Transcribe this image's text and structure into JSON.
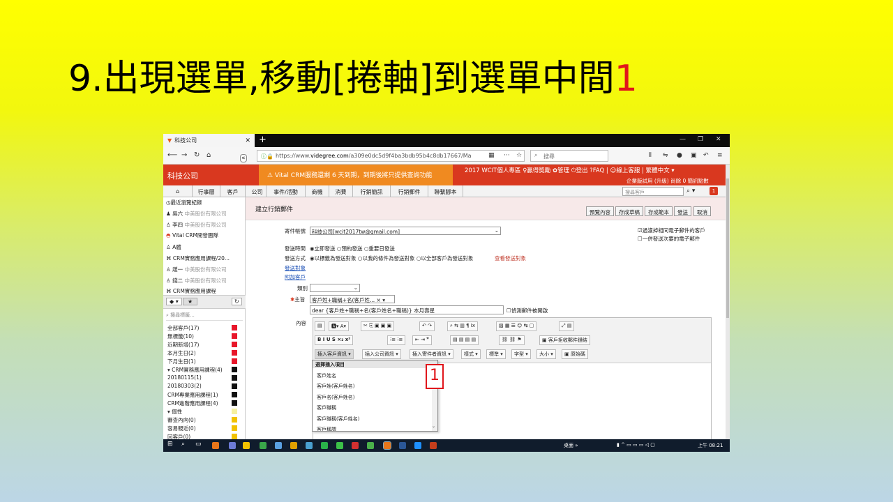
{
  "slide": {
    "title": "9.出現選單,移動[捲軸]到選單中間",
    "title_number": "1"
  },
  "browser": {
    "tab_title": "科技公司",
    "url_prefix": "https://www.",
    "url_host": "videgree.com",
    "url_rest": "/a309e0dc5d9f4ba3bdb95b4c8db17667/Ma",
    "search_placeholder": "搜尋"
  },
  "crm": {
    "logo": "科技公司",
    "notice": "⚠ Vital CRM服務還剩 6 天到期，到期後將只提供查詢功能",
    "top_links": "2017 WCIT個人專區 ♀贏得獎勵 ✿管理 ⏻登出 ?FAQ | ☺線上客服 | 繁體中文 ▾",
    "trial": "企業版試用 (升級) 尚餘 0 簡訊點數",
    "menu": [
      "⌂",
      "行事曆",
      "客戶",
      "公司",
      "事件/活動",
      "商機",
      "消費",
      "行銷簡訊",
      "行銷郵件",
      "聯繫腳本"
    ],
    "quick_search_placeholder": "搜尋客戶",
    "badge_count": "1"
  },
  "sidebar": {
    "recent_header": "最近瀏覽紀錄",
    "recent": [
      {
        "name": "吳六",
        "company": "中美股份有限公司"
      },
      {
        "name": "李四",
        "company": "中美股份有限公司"
      },
      {
        "name": "Vital CRM開發團隊",
        "company": ""
      },
      {
        "name": "A體",
        "company": ""
      },
      {
        "name": "CRM實務應用課程/20...",
        "company": ""
      },
      {
        "name": "趙一",
        "company": "中美股份有限公司"
      },
      {
        "name": "錢二",
        "company": "中美股份有限公司"
      },
      {
        "name": "CRM實務應用課程",
        "company": ""
      }
    ],
    "tag_search_placeholder": "搜尋標籤...",
    "tags": [
      {
        "label": "全部客戶(17)",
        "color": "#e8162a"
      },
      {
        "label": "無標籤(10)",
        "color": "#e8162a"
      },
      {
        "label": "近期新增(17)",
        "color": "#e8162a"
      },
      {
        "label": "本月生日(2)",
        "color": "#e8162a"
      },
      {
        "label": "下月生日(1)",
        "color": "#e8162a"
      },
      {
        "label": "▾ CRM實務應用課程(4)",
        "color": "#111111"
      },
      {
        "label": "  20180115(1)",
        "color": "#111111"
      },
      {
        "label": "  20180303(2)",
        "color": "#111111"
      },
      {
        "label": "CRM專業應用課程(1)",
        "color": "#111111"
      },
      {
        "label": "CRM進階應用課程(4)",
        "color": "#111111"
      },
      {
        "label": "▾ 個性",
        "color": "#f6f0a0"
      },
      {
        "label": "  審查內向(0)",
        "color": "#f2c200"
      },
      {
        "label": "  容易親近(0)",
        "color": "#f2c200"
      },
      {
        "label": "  回客戶(0)",
        "color": "#f2c200"
      }
    ]
  },
  "main": {
    "page_title": "建立行銷郵件",
    "buttons": [
      "預覽內容",
      "存成草稿",
      "存成範本",
      "發送",
      "取消"
    ],
    "sender_label": "寄件帳號",
    "sender_value": "科技公司[wcit2017tw@gmail.com]",
    "filter1": "☑過濾掉相同電子郵件的客戶",
    "filter2": "☐一併發送次要的電子郵件",
    "send_time_label": "發送時間",
    "send_time_options": "◉立即發送  ○預約發送  ○重要日發送",
    "send_method_label": "發送方式",
    "send_method_options": "◉以標籤為發送對象  ○以我的條件為發送對象  ○以全部客戶為發送對象",
    "view_targets": "查看發送對象",
    "send_targets_link": "發送對象",
    "attach_link": "附加客戶",
    "category_label": "類別",
    "subject_label": "主旨",
    "subject_select": "客戶姓+職稱+名(客戶姓... × ▾",
    "subject_value": "dear {客戶姓+職稱+名(客戶姓名+職稱)} 本月壽星",
    "track_label": "☐偵測郵件被開啟",
    "content_label": "內容",
    "editor_row3": [
      "插入客戶資訊 ▾",
      "插入公司資訊 ▾",
      "插入寄件者資訊 ▾",
      "樣式 ▾",
      "標準 ▾",
      "字型 ▾",
      "大小 ▾",
      "原始碼"
    ],
    "unsubscribe_btn": "客戶拒收郵件鏈結",
    "dropdown_header": "選擇插入項目",
    "dropdown_items": [
      "客戶姓名",
      "客戶姓(客戶姓名)",
      "客戶名(客戶姓名)",
      "客戶職稱",
      "客戶職稱(客戶姓名)",
      "客戶稱謂"
    ],
    "callout": "1"
  },
  "taskbar": {
    "desktop": "桌面",
    "time": "上午 08:21"
  }
}
